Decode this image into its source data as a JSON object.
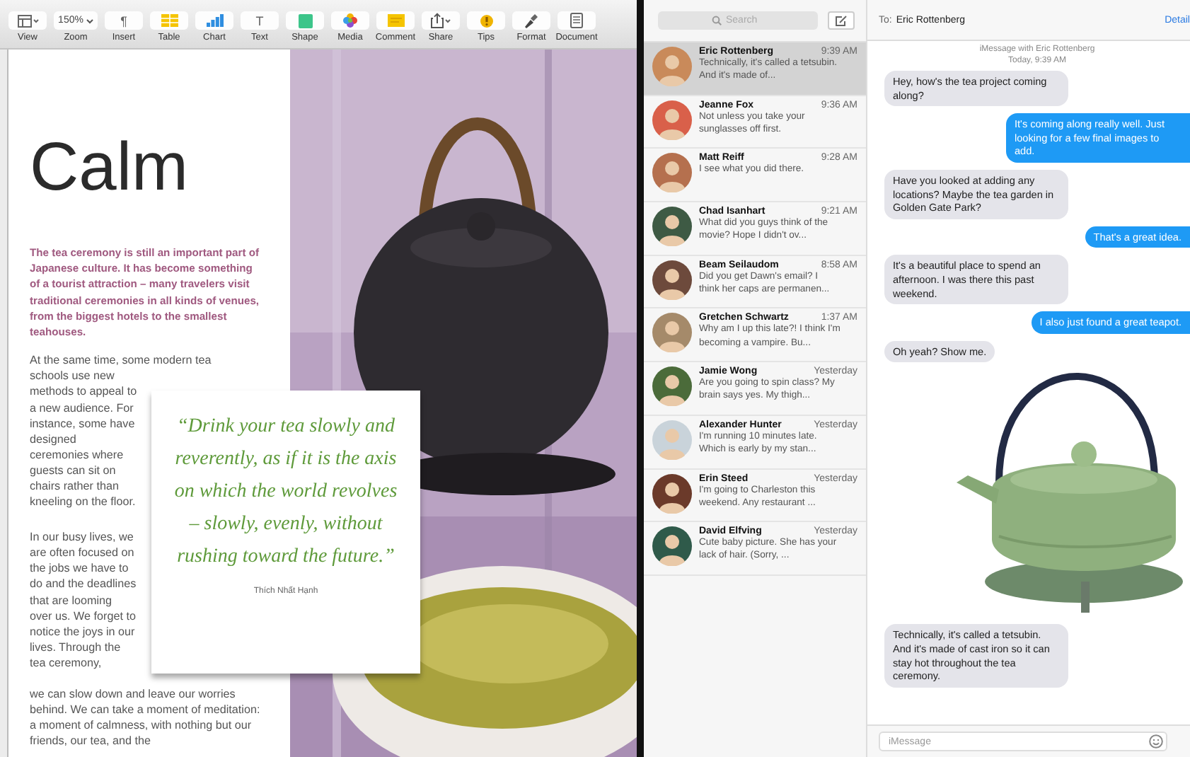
{
  "toolbar": [
    {
      "label": "View"
    },
    {
      "label": "Zoom",
      "value": "150%"
    },
    {
      "label": "Insert",
      "glyph": "¶"
    },
    {
      "label": "Table"
    },
    {
      "label": "Chart"
    },
    {
      "label": "Text",
      "glyph": "T"
    },
    {
      "label": "Shape"
    },
    {
      "label": "Media"
    },
    {
      "label": "Comment"
    },
    {
      "label": "Share"
    },
    {
      "label": "Tips"
    },
    {
      "label": "Format"
    },
    {
      "label": "Document"
    }
  ],
  "document": {
    "title": "Calm",
    "intro": "The tea ceremony is still an important part of Japanese culture. It has become something of a tourist attraction – many travelers visit traditional ceremonies in all kinds of venues, from the biggest hotels to the smallest teahouses.",
    "paragraphs": [
      [
        "At the same time, some modern tea",
        "schools use new methods to appeal to a new audience. For instance, some have designed ceremonies where guests can sit on chairs rather than kneeling on the floor."
      ],
      [
        "In our busy lives, we are often focused on the jobs we have to do and the deadlines that are looming over us. We forget to notice the joys in our lives. Through the tea ceremony,",
        "we can slow down and leave our worries behind. We can take a moment of meditation: a moment of calmness, with nothing but our friends, our tea, and the"
      ]
    ],
    "quote": {
      "text": "“Drink your tea slowly and reverently, as if it is the axis on which the world revolves – slowly, evenly, without rushing toward the future.”",
      "author": "Thích Nhất Hạnh"
    }
  },
  "conversations": {
    "search": {
      "placeholder": "Search"
    },
    "items": [
      {
        "name": "Eric Rottenberg",
        "time": "9:39 AM",
        "preview": "Technically, it's called a tetsubin. And it's made of...",
        "selected": true
      },
      {
        "name": "Jeanne Fox",
        "time": "9:36 AM",
        "preview": "Not unless you take your sunglasses off first.",
        "selected": false
      },
      {
        "name": "Matt Reiff",
        "time": "9:28 AM",
        "preview": "I see what you did there.",
        "selected": false
      },
      {
        "name": "Chad Isanhart",
        "time": "9:21 AM",
        "preview": "What did you guys think of the movie? Hope I didn't ov...",
        "selected": false
      },
      {
        "name": "Beam Seilaudom",
        "time": "8:58 AM",
        "preview": "Did you get Dawn's email? I think her caps are permanen...",
        "selected": false
      },
      {
        "name": "Gretchen Schwartz",
        "time": "1:37 AM",
        "preview": "Why am I up this late?! I think I'm becoming a vampire. Bu...",
        "selected": false
      },
      {
        "name": "Jamie Wong",
        "time": "Yesterday",
        "preview": "Are you going to spin class? My brain says yes. My thigh...",
        "selected": false
      },
      {
        "name": "Alexander Hunter",
        "time": "Yesterday",
        "preview": "I'm running 10 minutes late. Which is early by my stan...",
        "selected": false
      },
      {
        "name": "Erin Steed",
        "time": "Yesterday",
        "preview": "I'm going to Charleston this weekend. Any restaurant ...",
        "selected": false
      },
      {
        "name": "David Elfving",
        "time": "Yesterday",
        "preview": "Cute baby picture. She has your lack of hair. (Sorry, ...",
        "selected": false
      }
    ]
  },
  "chat": {
    "to_label": "To:",
    "recipient": "Eric Rottenberg",
    "details": "Detail",
    "info": [
      "iMessage with  Eric Rottenberg",
      "Today, 9:39 AM"
    ],
    "messages": [
      {
        "kind": "received",
        "text": "Hey, how's the tea project coming along?"
      },
      {
        "kind": "sent",
        "text": "It's coming along really well. Just looking for a few final images to add."
      },
      {
        "kind": "received",
        "text": "Have you looked at adding any locations? Maybe the tea garden in Golden Gate Park?"
      },
      {
        "kind": "sent",
        "text": "That's a great idea."
      },
      {
        "kind": "received",
        "text": "It's a beautiful place to spend an afternoon. I was there this past weekend."
      },
      {
        "kind": "sent",
        "text": "I also just found a great teapot."
      },
      {
        "kind": "received",
        "text": "Oh yeah? Show me."
      },
      {
        "kind": "picture"
      },
      {
        "kind": "received",
        "text": "Technically, it's called a tetsubin. And it's made of cast iron so it can stay hot throughout the tea ceremony."
      }
    ],
    "input": {
      "placeholder": "iMessage"
    }
  }
}
